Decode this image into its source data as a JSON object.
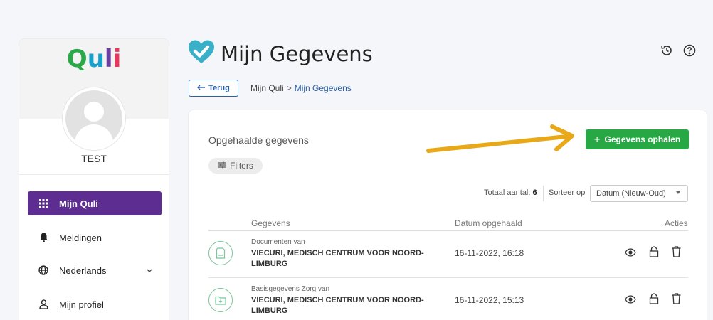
{
  "sidebar": {
    "logo": {
      "q": "Q",
      "u": "u",
      "l": "l",
      "i": "i"
    },
    "username": "TEST",
    "items": [
      {
        "label": "Mijn Quli",
        "icon": "grid-icon",
        "active": true
      },
      {
        "label": "Meldingen",
        "icon": "bell-icon"
      },
      {
        "label": "Nederlands",
        "icon": "globe-icon"
      },
      {
        "label": "Mijn profiel",
        "icon": "user-icon"
      }
    ]
  },
  "header": {
    "title": "Mijn Gegevens",
    "back_label": "Terug",
    "breadcrumb": {
      "root": "Mijn Quli",
      "sep": ">",
      "current": "Mijn Gegevens"
    }
  },
  "card": {
    "title": "Opgehaalde gegevens",
    "filters_label": "Filters",
    "fetch_label": "Gegevens ophalen",
    "fetch_plus": "+",
    "total_label": "Totaal aantal:",
    "total_value": "6",
    "sort_label": "Sorteer op",
    "sort_value": "Datum (Nieuw-Oud)",
    "columns": {
      "gegevens": "Gegevens",
      "datum": "Datum opgehaald",
      "acties": "Acties"
    },
    "rows": [
      {
        "sub": "Documenten van",
        "main": "VIECURI, MEDISCH CENTRUM VOOR NOORD-LIMBURG",
        "date": "16-11-2022, 16:18",
        "icon": "document-icon"
      },
      {
        "sub": "Basisgegevens Zorg van",
        "main": "VIECURI, MEDISCH CENTRUM VOOR NOORD-LIMBURG",
        "date": "16-11-2022, 15:13",
        "icon": "medical-folder-icon"
      }
    ]
  },
  "colors": {
    "accent": "#5e2d91",
    "green": "#28a745",
    "link": "#2b5fa8",
    "arrow": "#e8a817"
  }
}
